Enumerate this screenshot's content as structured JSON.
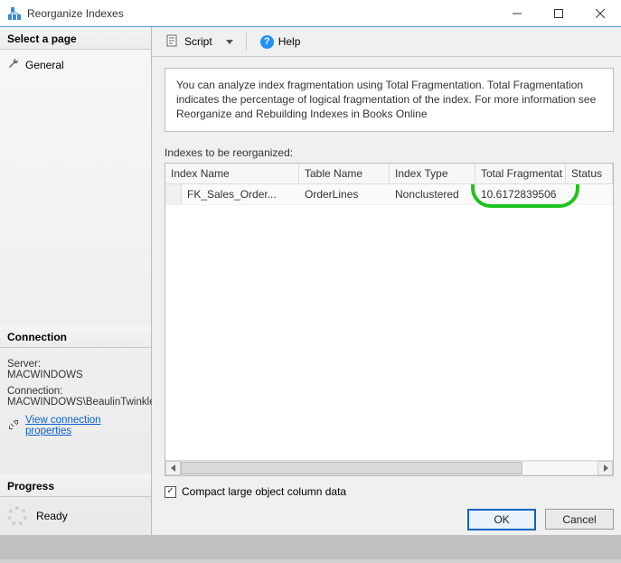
{
  "window": {
    "title": "Reorganize Indexes"
  },
  "sidebar": {
    "select_page_title": "Select a page",
    "pages": [
      {
        "label": "General"
      }
    ],
    "connection_title": "Connection",
    "server_label": "Server:",
    "server_value": "MACWINDOWS",
    "connection_label": "Connection:",
    "connection_value": "MACWINDOWS\\BeaulinTwinkle",
    "view_props_link": "View connection properties",
    "progress_title": "Progress",
    "progress_status": "Ready"
  },
  "toolbar": {
    "script_label": "Script",
    "help_label": "Help"
  },
  "main": {
    "info_text": "You can analyze index fragmentation using Total Fragmentation. Total Fragmentation indicates the percentage of logical fragmentation of the index. For more information see Reorganize and Rebuilding Indexes in Books Online",
    "grid_label": "Indexes to be reorganized:",
    "columns": {
      "index_name": "Index Name",
      "table_name": "Table Name",
      "index_type": "Index Type",
      "total_frag": "Total Fragmentat",
      "status": "Status"
    },
    "rows": [
      {
        "index_name": "FK_Sales_Order...",
        "table_name": "OrderLines",
        "index_type": "Nonclustered",
        "total_frag": "10.6172839506",
        "status": ""
      }
    ],
    "compact_checkbox_label": "Compact large object column data",
    "compact_checked": true
  },
  "footer": {
    "ok_label": "OK",
    "cancel_label": "Cancel"
  }
}
